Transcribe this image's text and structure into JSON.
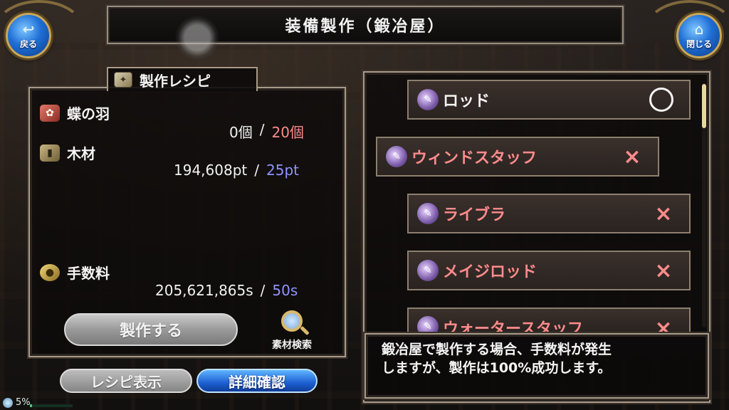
{
  "header": {
    "title": "装備製作（鍛冶屋）",
    "back_label": "戻る",
    "close_label": "閉じる"
  },
  "recipe": {
    "header_label": "製作レシピ",
    "materials": [
      {
        "name": "蝶の羽",
        "have": "0個",
        "separator": "/",
        "need": "20個",
        "icon": "feather-icon"
      },
      {
        "name": "木材",
        "have": "194,608pt",
        "separator": "/",
        "need": "25pt",
        "icon": "wood-icon"
      }
    ],
    "fee": {
      "name": "手数料",
      "have": "205,621,865s",
      "separator": "/",
      "need": "50s",
      "icon": "coin-icon"
    }
  },
  "buttons": {
    "craft_label": "製作する",
    "search_label": "素材検索",
    "recipe_view_label": "レシピ表示",
    "detail_label": "詳細確認"
  },
  "weapons": [
    {
      "name": "ロッド",
      "mark": "○",
      "available": true
    },
    {
      "name": "ウィンドスタッフ",
      "mark": "×",
      "available": false,
      "selected": true
    },
    {
      "name": "ライブラ",
      "mark": "×",
      "available": false
    },
    {
      "name": "メイジロッド",
      "mark": "×",
      "available": false
    },
    {
      "name": "ウォータースタッフ",
      "mark": "×",
      "available": false
    }
  ],
  "description": "鍛冶屋で製作する場合、手数料が発生\nしますが、製作は100%成功します。",
  "status": {
    "progress_label": "5%",
    "progress": 0.05
  },
  "colors": {
    "need_materials": "#ff8b8b",
    "need_points": "#8f93ff",
    "accent_blue": "#1f6fd6",
    "frame": "#a79a88"
  }
}
